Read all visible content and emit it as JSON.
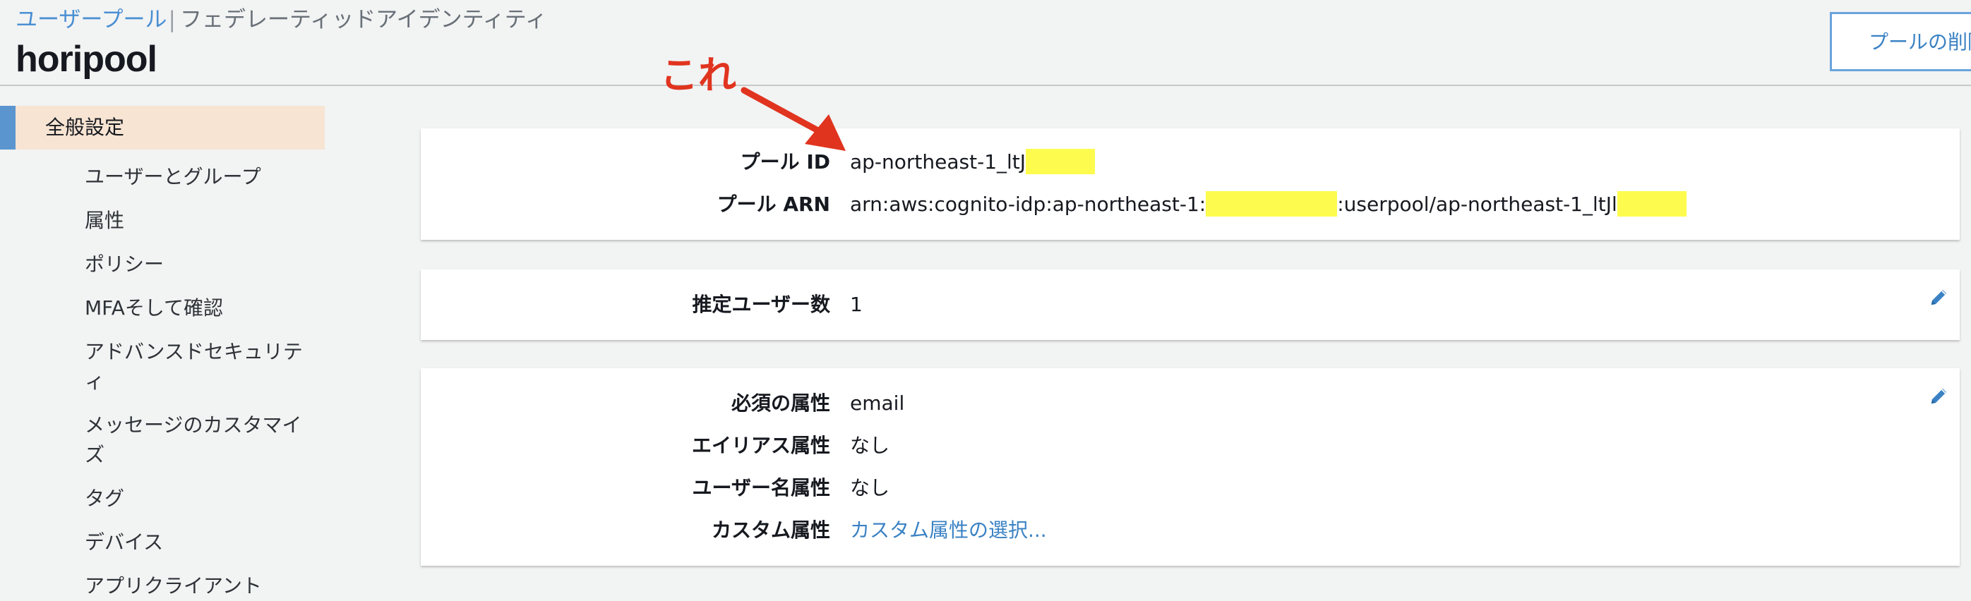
{
  "header": {
    "breadcrumb_link": "ユーザープール",
    "breadcrumb_sep": "|",
    "breadcrumb_current": "フェデレーティッドアイデンティティ",
    "title": "horipool",
    "delete_button": "プールの削除"
  },
  "sidebar": {
    "active": "全般設定",
    "items": [
      {
        "label": "ユーザーとグループ"
      },
      {
        "label": "属性"
      },
      {
        "label": "ポリシー"
      },
      {
        "label": "MFAそして確認"
      },
      {
        "label": "アドバンスドセキュリティ"
      },
      {
        "label": "メッセージのカスタマイズ"
      },
      {
        "label": "タグ"
      },
      {
        "label": "デバイス"
      },
      {
        "label": "アプリクライアント"
      }
    ]
  },
  "pool_info": {
    "pool_id_label": "プール ID",
    "pool_id_value": "ap-northeast-1_ltJ",
    "pool_arn_label": "プール ARN",
    "pool_arn_prefix": "arn:aws:cognito-idp:ap-northeast-1:",
    "pool_arn_middle": ":userpool/ap-northeast-1_ltJl"
  },
  "users": {
    "estimated_label": "推定ユーザー数",
    "estimated_value": "1"
  },
  "attributes": {
    "required_label": "必須の属性",
    "required_value": "email",
    "alias_label": "エイリアス属性",
    "alias_value": "なし",
    "username_label": "ユーザー名属性",
    "username_value": "なし",
    "custom_label": "カスタム属性",
    "custom_value": "カスタム属性の選択..."
  },
  "annotation": {
    "text": "これ",
    "color": "#e0341f"
  },
  "colors": {
    "accent": "#4a8fd3",
    "highlight": "#fdfc4e",
    "active_nav_bg": "#f7e4d3"
  },
  "icons": {
    "edit": "pencil-icon"
  }
}
